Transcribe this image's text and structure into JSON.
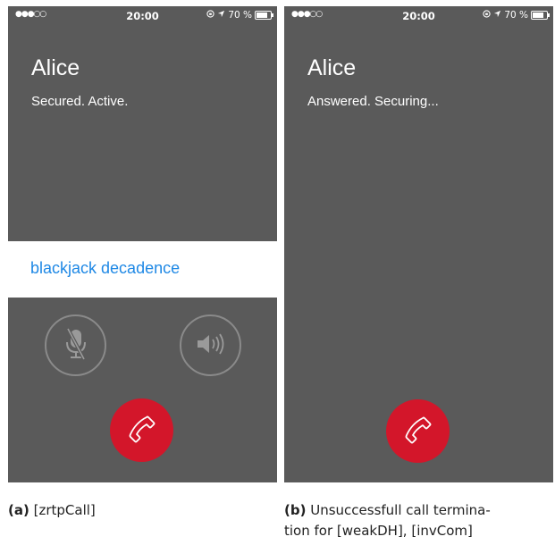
{
  "screen_a": {
    "status_bar": {
      "signal": "●●●○○",
      "time": "20:00",
      "battery": "70 %",
      "icons": [
        "rotation-lock-icon",
        "location-arrow-icon",
        "battery-icon"
      ]
    },
    "caller_name": "Alice",
    "call_status": "Secured. Active.",
    "sas_words": "blackjack decadence",
    "buttons": {
      "mute": "microphone-muted-icon",
      "speaker": "speaker-icon",
      "end": "phone-hangup-icon"
    }
  },
  "screen_b": {
    "status_bar": {
      "signal": "●●●○○",
      "time": "20:00",
      "battery": "70 %",
      "icons": [
        "rotation-lock-icon",
        "location-arrow-icon",
        "battery-icon"
      ]
    },
    "caller_name": "Alice",
    "call_status": "Answered. Securing...",
    "buttons": {
      "end": "phone-hangup-icon"
    }
  },
  "captions": {
    "a_label": "(a)",
    "a_text": "[zrtpCall]",
    "b_label": "(b)",
    "b_text_line1": "Unsuccessfull call termina-",
    "b_text_line2": "tion for [weakDH], [invCom]"
  },
  "colors": {
    "screen_bg": "#5a5a5a",
    "end_call": "#d3162a",
    "sas_text": "#1e88e5"
  }
}
